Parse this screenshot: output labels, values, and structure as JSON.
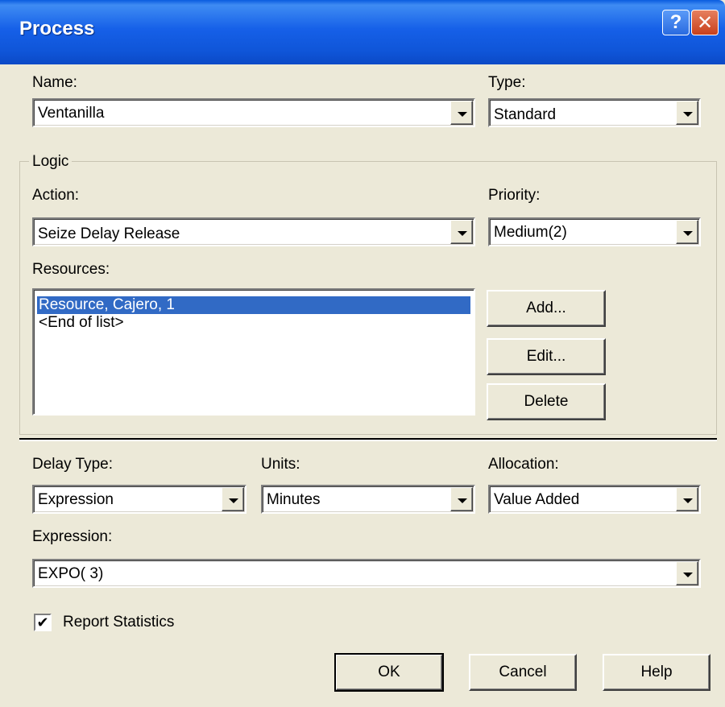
{
  "window": {
    "title": "Process",
    "help_glyph": "?",
    "close_glyph": "✕"
  },
  "name_field": {
    "label": "Name:",
    "value": "Ventanilla"
  },
  "type_field": {
    "label": "Type:",
    "value": "Standard"
  },
  "logic": {
    "legend": "Logic",
    "action": {
      "label": "Action:",
      "value": "Seize Delay Release"
    },
    "priority": {
      "label": "Priority:",
      "value": "Medium(2)"
    },
    "resources": {
      "label": "Resources:",
      "items": [
        "Resource, Cajero, 1",
        "<End of list>"
      ],
      "selected_index": 0
    },
    "buttons": {
      "add": "Add...",
      "edit": "Edit...",
      "delete": "Delete"
    }
  },
  "delay": {
    "delay_type": {
      "label": "Delay Type:",
      "value": "Expression"
    },
    "units": {
      "label": "Units:",
      "value": "Minutes"
    },
    "allocation": {
      "label": "Allocation:",
      "value": "Value Added"
    },
    "expression": {
      "label": "Expression:",
      "value": "EXPO( 3)"
    }
  },
  "report_statistics": {
    "label": "Report Statistics",
    "checked": true,
    "check_glyph": "✔"
  },
  "footer": {
    "ok": "OK",
    "cancel": "Cancel",
    "help": "Help"
  },
  "colors": {
    "titlebar": "#0f55d8",
    "selection": "#316ac5",
    "dialog_bg": "#ece9d8"
  }
}
